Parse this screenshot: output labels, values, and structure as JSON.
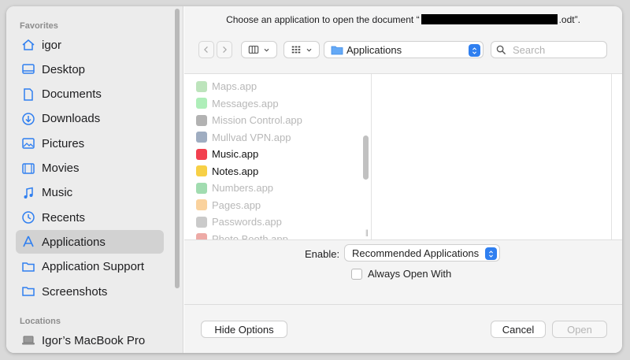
{
  "dialog": {
    "title_prefix": "Choose an application to open the document “",
    "title_suffix": ".odt”."
  },
  "sidebar": {
    "favorites_label": "Favorites",
    "items": [
      {
        "label": "igor",
        "icon": "home-icon"
      },
      {
        "label": "Desktop",
        "icon": "desktop-icon"
      },
      {
        "label": "Documents",
        "icon": "document-icon"
      },
      {
        "label": "Downloads",
        "icon": "download-icon"
      },
      {
        "label": "Pictures",
        "icon": "photo-icon"
      },
      {
        "label": "Movies",
        "icon": "film-icon"
      },
      {
        "label": "Music",
        "icon": "music-note-icon"
      },
      {
        "label": "Recents",
        "icon": "clock-icon"
      },
      {
        "label": "Applications",
        "icon": "applications-icon",
        "selected": true
      },
      {
        "label": "Application Support",
        "icon": "folder-icon"
      },
      {
        "label": "Screenshots",
        "icon": "folder-icon"
      }
    ],
    "locations_label": "Locations",
    "locations": [
      {
        "label": "Igor’s MacBook Pro",
        "icon": "laptop-icon"
      }
    ]
  },
  "toolbar": {
    "location": "Applications",
    "search_placeholder": "Search"
  },
  "apps": [
    {
      "name": "Maps.app",
      "enabled": false,
      "color": "#6cc46a"
    },
    {
      "name": "Messages.app",
      "enabled": false,
      "color": "#4cd964"
    },
    {
      "name": "Mission Control.app",
      "enabled": false,
      "color": "#555555"
    },
    {
      "name": "Mullvad VPN.app",
      "enabled": false,
      "color": "#2b4a76"
    },
    {
      "name": "Music.app",
      "enabled": true,
      "color": "#f2404f"
    },
    {
      "name": "Notes.app",
      "enabled": true,
      "color": "#f7d046"
    },
    {
      "name": "Numbers.app",
      "enabled": false,
      "color": "#2fb24f"
    },
    {
      "name": "Pages.app",
      "enabled": false,
      "color": "#f59b26"
    },
    {
      "name": "Passwords.app",
      "enabled": false,
      "color": "#8a8a8a"
    },
    {
      "name": "Photo Booth.app",
      "enabled": false,
      "color": "#d6423a"
    }
  ],
  "options": {
    "enable_label": "Enable:",
    "enable_value": "Recommended Applications",
    "always_open_label": "Always Open With"
  },
  "buttons": {
    "hide_options": "Hide Options",
    "cancel": "Cancel",
    "open": "Open"
  },
  "colors": {
    "accent": "#2f7ff0",
    "sidebar_icon": "#2f7ff0"
  }
}
